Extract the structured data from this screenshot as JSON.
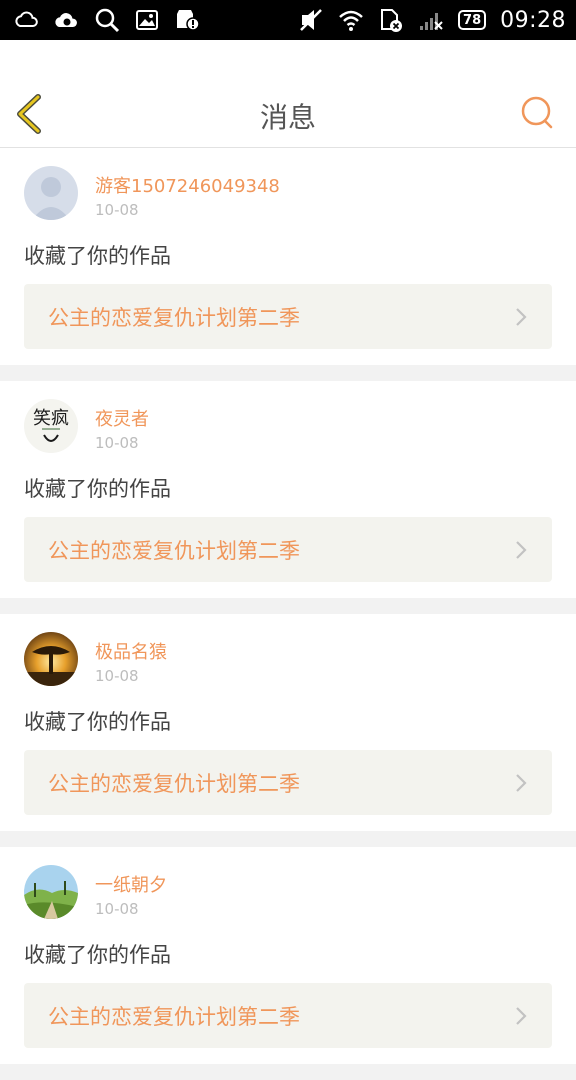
{
  "status_bar": {
    "time": "09:28",
    "battery": "78",
    "icons": [
      "weather-cloud-icon",
      "cloud-sync-icon",
      "search-icon",
      "image-icon",
      "store-alert-icon",
      "silent-icon",
      "wifi-icon",
      "sim-off-icon",
      "signal-off-icon",
      "battery-icon"
    ]
  },
  "header": {
    "title": "消息",
    "back_icon": "chevron-left-icon",
    "search_icon": "search-icon",
    "accent_color": "#f0965a"
  },
  "messages": [
    {
      "username": "游客1507246049348",
      "date": "10-08",
      "action": "收藏了你的作品",
      "work_title": "公主的恋爱复仇计划第二季",
      "avatar": "default-avatar-icon"
    },
    {
      "username": "夜灵者",
      "date": "10-08",
      "action": "收藏了你的作品",
      "work_title": "公主的恋爱复仇计划第二季",
      "avatar": "calligraphy-avatar",
      "avatar_text": "笑疯"
    },
    {
      "username": "极品名猿",
      "date": "10-08",
      "action": "收藏了你的作品",
      "work_title": "公主的恋爱复仇计划第二季",
      "avatar": "sunset-tree-avatar"
    },
    {
      "username": "一纸朝夕",
      "date": "10-08",
      "action": "收藏了你的作品",
      "work_title": "公主的恋爱复仇计划第二季",
      "avatar": "landscape-avatar"
    }
  ]
}
